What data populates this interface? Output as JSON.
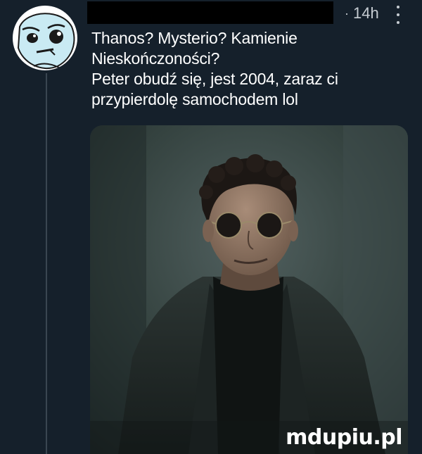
{
  "tweet": {
    "time_separator": "·",
    "time": "14h",
    "text_line_1": "Thanos? Mysterio? Kamienie Nieskończoności?",
    "text_line_2": "Peter obudź się, jest 2004, zaraz ci przypierdolę samochodem lol"
  },
  "icons": {
    "avatar": "meme-face-avatar",
    "more": "more-options-icon"
  },
  "watermark": {
    "text": "mdupiu.pl"
  },
  "colors": {
    "background": "#15202b",
    "text": "#ffffff",
    "muted": "#c7cdd3",
    "thread_line": "#3a4651"
  }
}
